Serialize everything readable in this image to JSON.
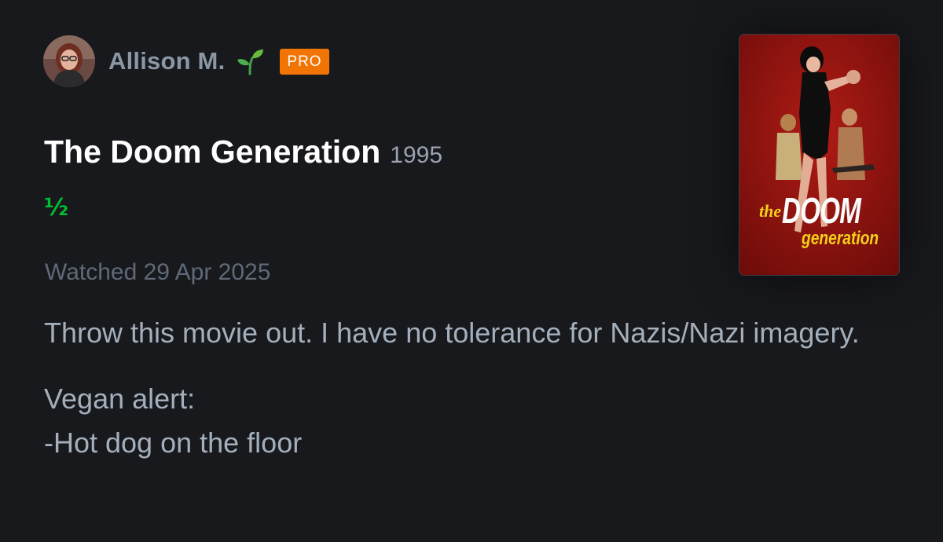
{
  "author": {
    "name": "Allison M.",
    "badge_icon": "sprout-icon",
    "pro_label": "PRO"
  },
  "film": {
    "title": "The Doom Generation",
    "year": "1995",
    "rating": "½",
    "poster": {
      "title_the": "the",
      "title_doom": "DOOM",
      "title_generation": "generation"
    }
  },
  "review": {
    "watched": "Watched 29 Apr 2025",
    "paragraph1": "Throw this movie out. I have no tolerance for Nazis/Nazi imagery.",
    "paragraph2_line1": "Vegan alert:",
    "paragraph2_line2": "-Hot dog on the floor"
  },
  "colors": {
    "background": "#18191d",
    "pro_badge": "#f27405",
    "rating_green": "#00c030",
    "author_name": "#8c97a5",
    "body_text": "#a4afbc"
  }
}
